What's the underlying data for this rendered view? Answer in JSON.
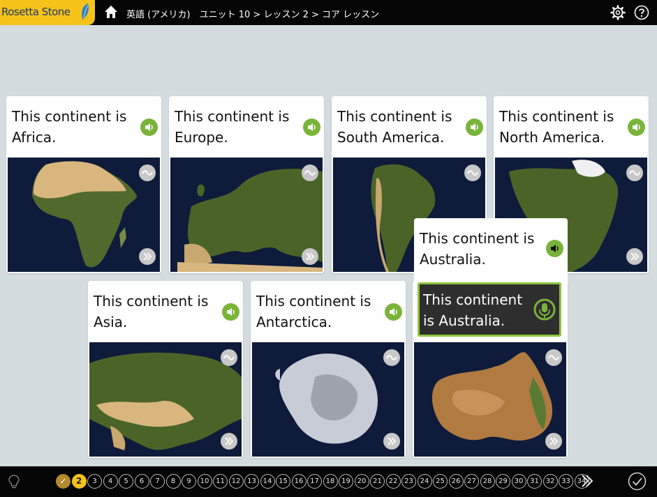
{
  "app": {
    "logo_text": "Rosetta Stone",
    "breadcrumb": "英語 (アメリカ)　ユニット 10 > レッスン 2 > コア レッスン"
  },
  "colors": {
    "brand_yellow": "#f5c21a",
    "accent_green": "#7ab33a",
    "speak_border": "#8cc63f",
    "topbar": "#050505"
  },
  "icons": {
    "home": "home-icon",
    "settings": "gear-icon",
    "help": "question-icon",
    "speaker": "speaker-icon",
    "wave": "waveform-icon",
    "next": "double-chevron-icon",
    "mic": "microphone-icon",
    "hint": "lightbulb-icon",
    "done": "checkmark-icon"
  },
  "cards": [
    {
      "caption": "This continent is Africa.",
      "image": "africa-map"
    },
    {
      "caption": "This continent is Europe.",
      "image": "europe-map"
    },
    {
      "caption": "This continent is South America.",
      "image": "south-america-map"
    },
    {
      "caption": "This continent is North America.",
      "image": "north-america-map"
    },
    {
      "caption": "This continent is Asia.",
      "image": "asia-map"
    },
    {
      "caption": "This continent is Antarctica.",
      "image": "antarctica-map"
    },
    {
      "caption": "This continent is Australia.",
      "image": "australia-map"
    }
  ],
  "speak_prompt": {
    "caption": "This continent is Australia.",
    "response_text": "This continent is Australia."
  },
  "progress": {
    "completed_steps": 1,
    "current_step": "2",
    "steps": [
      "3",
      "4",
      "5",
      "6",
      "7",
      "8",
      "9",
      "10",
      "11",
      "12",
      "13",
      "14",
      "15",
      "16",
      "17",
      "18",
      "19",
      "20",
      "21",
      "22",
      "23",
      "24",
      "25",
      "26",
      "27",
      "28",
      "29",
      "30",
      "31",
      "32",
      "33",
      "34"
    ]
  }
}
